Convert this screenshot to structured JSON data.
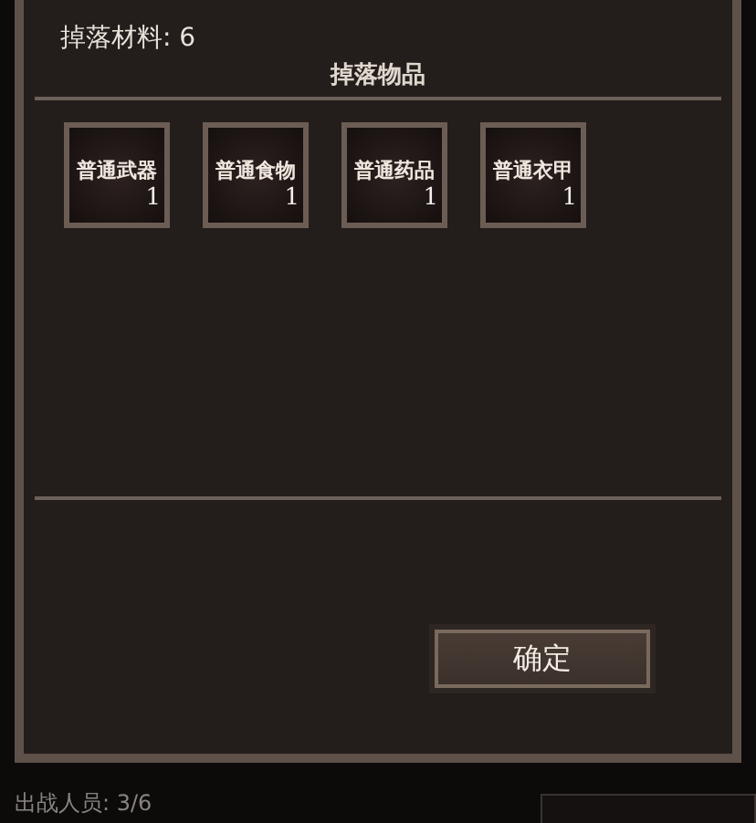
{
  "drop_materials": {
    "label": "掉落材料:",
    "value": "6"
  },
  "drop_items": {
    "title": "掉落物品",
    "items": [
      {
        "name": "普通武器",
        "count": "1"
      },
      {
        "name": "普通食物",
        "count": "1"
      },
      {
        "name": "普通药品",
        "count": "1"
      },
      {
        "name": "普通衣甲",
        "count": "1"
      }
    ]
  },
  "confirm_button": "确定",
  "status_bar": {
    "label": "出战人员:",
    "value": "3/6"
  }
}
